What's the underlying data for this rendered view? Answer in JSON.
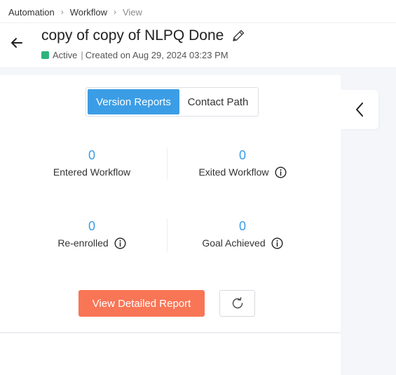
{
  "breadcrumb": {
    "items": [
      "Automation",
      "Workflow",
      "View"
    ],
    "separator": "›"
  },
  "header": {
    "title": "copy of copy of NLPQ Done",
    "status": "Active",
    "status_color": "#2fb27a",
    "meta_separator": "|",
    "created": "Created on Aug 29, 2024 03:23 PM"
  },
  "tabs": [
    {
      "label": "Version Reports",
      "active": true
    },
    {
      "label": "Contact Path",
      "active": false
    }
  ],
  "stats": [
    {
      "value": "0",
      "label": "Entered Workflow",
      "has_info": false
    },
    {
      "value": "0",
      "label": "Exited Workflow",
      "has_info": true
    },
    {
      "value": "0",
      "label": "Re-enrolled",
      "has_info": true
    },
    {
      "value": "0",
      "label": "Goal Achieved",
      "has_info": true
    }
  ],
  "actions": {
    "detailed_report_label": "View Detailed Report",
    "refresh_icon": "refresh-icon"
  },
  "colors": {
    "accent": "#3b9de6",
    "primary_button": "#f87556",
    "active_status": "#2fb27a"
  },
  "icons": {
    "back": "arrow-left-icon",
    "edit": "pencil-icon",
    "info": "info-icon",
    "collapse": "chevron-left-icon"
  }
}
